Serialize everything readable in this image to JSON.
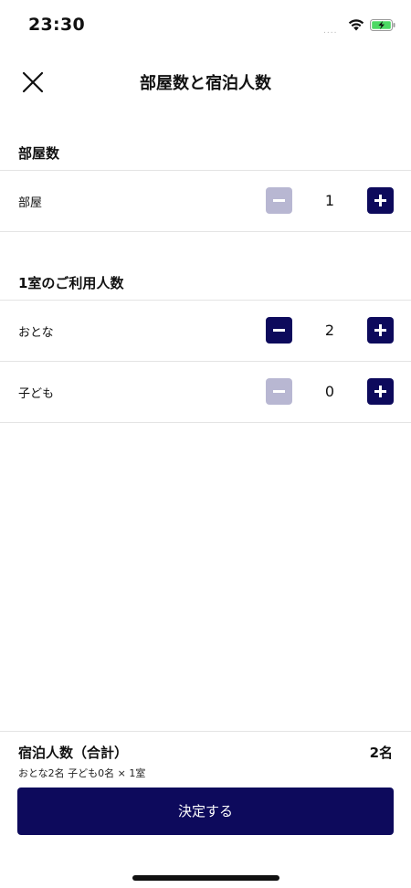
{
  "status_bar": {
    "time": "23:30",
    "signal": "....",
    "wifi_icon": "wifi-icon",
    "battery_icon": "battery-charging-icon"
  },
  "header": {
    "title": "部屋数と宿泊人数",
    "close_icon": "close-icon"
  },
  "rooms_section": {
    "heading": "部屋数",
    "rows": [
      {
        "label": "部屋",
        "value": "1",
        "minus_enabled": false,
        "plus_enabled": true
      }
    ]
  },
  "guests_section": {
    "heading": "1室のご利用人数",
    "rows": [
      {
        "label": "おとな",
        "value": "2",
        "minus_enabled": true,
        "plus_enabled": true
      },
      {
        "label": "子ども",
        "value": "0",
        "minus_enabled": false,
        "plus_enabled": true
      }
    ]
  },
  "summary": {
    "label": "宿泊人数（合計）",
    "value": "2名",
    "detail": "おとな2名 子ども0名 × 1室"
  },
  "confirm_label": "決定する",
  "colors": {
    "primary": "#0d0a5c",
    "disabled": "#b8b7d2",
    "divider": "#e4e4e4"
  }
}
